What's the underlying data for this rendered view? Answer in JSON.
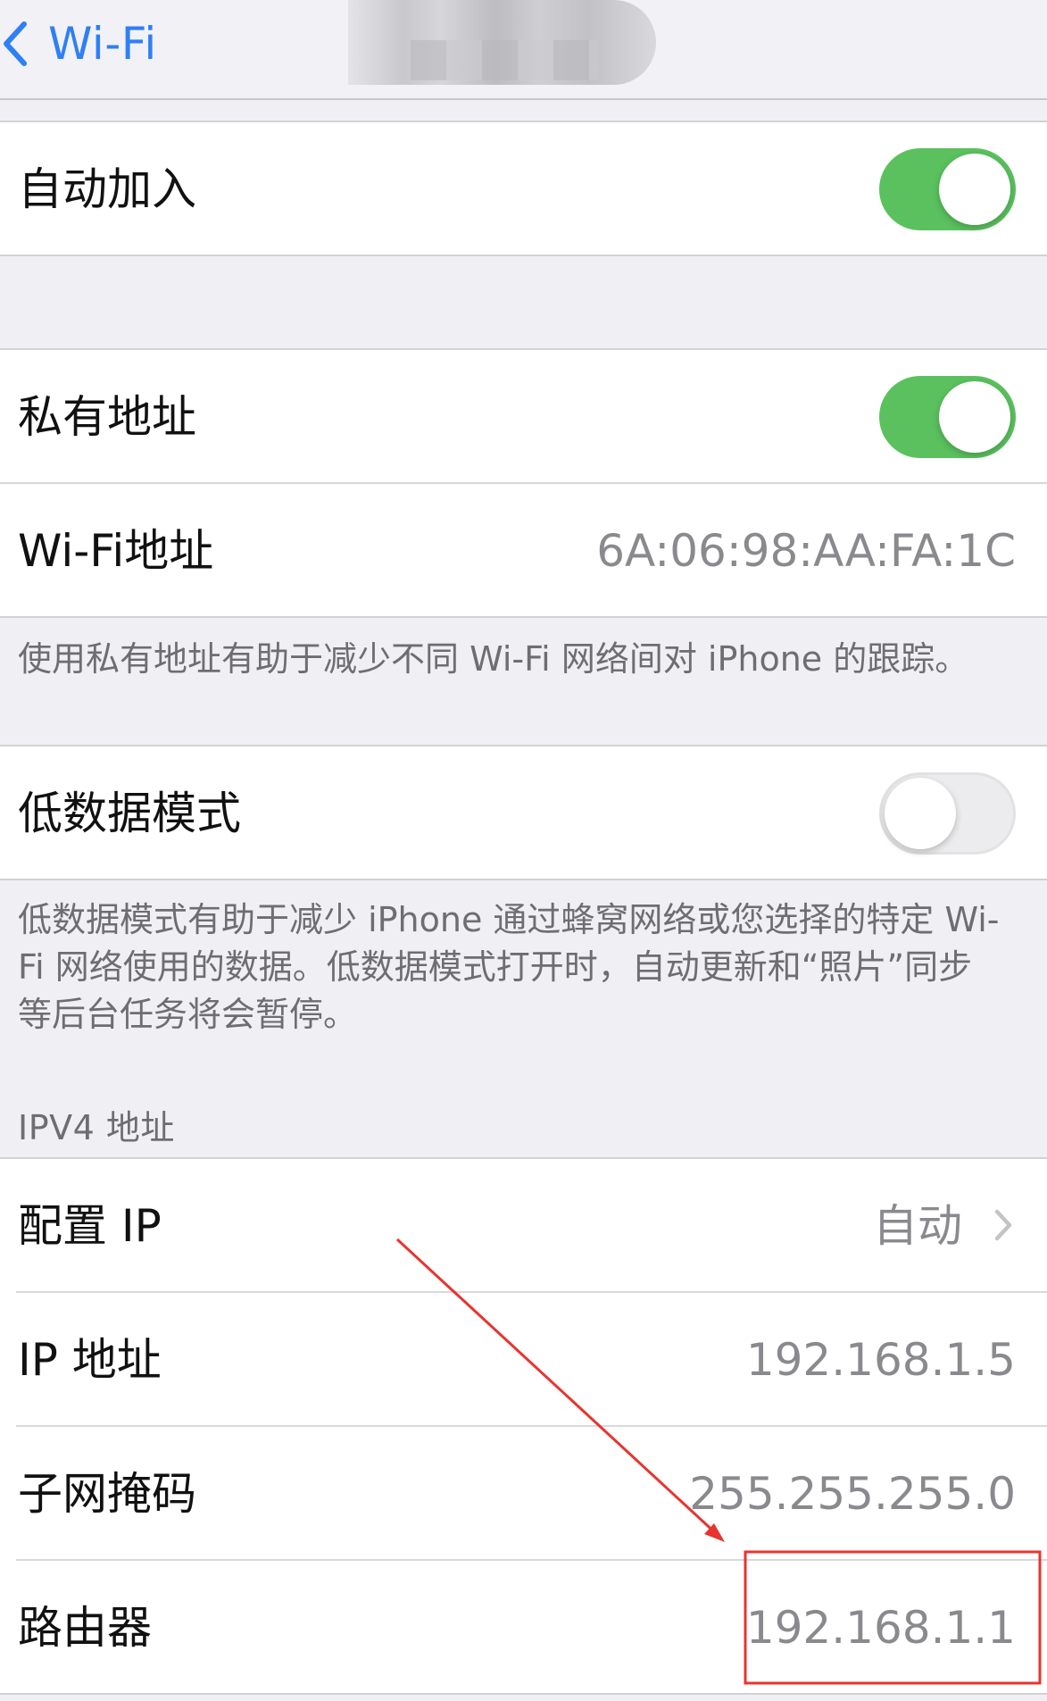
{
  "nav": {
    "back_label": "Wi-Fi",
    "back_icon": "chevron-left-icon",
    "accent_color": "#2f7ff6"
  },
  "auto_join": {
    "label": "自动加入",
    "on": true
  },
  "private_address": {
    "label": "私有地址",
    "on": true
  },
  "wifi_address": {
    "label": "Wi-Fi地址",
    "value": "6A:06:98:AA:FA:1C"
  },
  "private_address_footer": "使用私有地址有助于减少不同 Wi-Fi 网络间对 iPhone 的跟踪。",
  "low_data_mode": {
    "label": "低数据模式",
    "on": false
  },
  "low_data_footer_lines": [
    "低数据模式有助于减少 iPhone 通过蜂窝网络或您选择的特定 Wi-",
    "Fi 网络使用的数据。低数据模式打开时，自动更新和“照片”同步",
    "等后台任务将会暂停。"
  ],
  "ipv4": {
    "header": "IPV4 地址",
    "configure": {
      "label": "配置 IP",
      "value": "自动"
    },
    "ip_address": {
      "label": "IP 地址",
      "value": "192.168.1.5"
    },
    "subnet_mask": {
      "label": "子网掩码",
      "value": "255.255.255.0"
    },
    "router": {
      "label": "路由器",
      "value": "192.168.1.1"
    }
  },
  "colors": {
    "toggle_on": "#5ac15e",
    "annotation_red": "#e8342e"
  }
}
